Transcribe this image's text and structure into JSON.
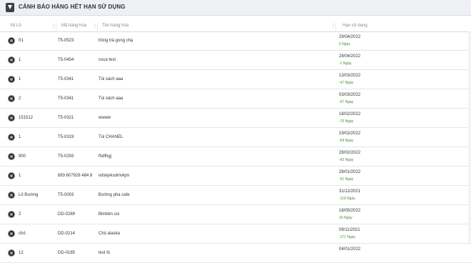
{
  "panel": {
    "icon": "funnel-icon",
    "title": "CẢNH BÁO HÀNG HẾT HẠN SỬ DỤNG"
  },
  "columns": [
    "Số Lô",
    "Mã hàng hóa",
    "Tên hàng hóa",
    "Hạn sử dụng"
  ],
  "rows": [
    {
      "lot": "fr1",
      "code": "T5-0523",
      "name": "hồng trà gong chạ",
      "date": "29/04/2022",
      "days": "0 Ngày"
    },
    {
      "lot": "1",
      "code": "T5-0454",
      "name": "coca test",
      "date": "28/04/2022",
      "days": "-1 Ngày"
    },
    {
      "lot": "1",
      "code": "T5-0341",
      "name": "Túi xách aaa",
      "date": "13/03/2022",
      "days": "-47 Ngày"
    },
    {
      "lot": "2",
      "code": "T5-0341",
      "name": "Túi xách aaa",
      "date": "03/03/2022",
      "days": "-57 Ngày"
    },
    {
      "lot": "151512",
      "code": "T5-0321",
      "name": "wwww",
      "date": "18/02/2022",
      "days": "-70 Ngày"
    },
    {
      "lot": "1",
      "code": "T5-0319",
      "name": "Túi CHANEL",
      "date": "19/02/2022",
      "days": "-69 Ngày"
    },
    {
      "lot": "900",
      "code": "T5-0293",
      "name": "fhdfhgj",
      "date": "28/02/2022",
      "days": "-60 Ngày"
    },
    {
      "lot": "1",
      "code": "893 607928 484 8",
      "name": "vdskjvksdmvkjm",
      "date": "28/01/2022",
      "days": "-91 Ngày"
    },
    {
      "lot": "Lô Đường",
      "code": "T5-0003",
      "name": "Đường pha cafe",
      "date": "31/12/2021",
      "days": "-119 Ngày"
    },
    {
      "lot": "2",
      "code": "DD-0289",
      "name": "Bimbim osi",
      "date": "18/05/2022",
      "days": "19 Ngày"
    },
    {
      "lot": "chó",
      "code": "DD-0214",
      "name": "Chó alaska",
      "date": "09/11/2021",
      "days": "-171 Ngày"
    },
    {
      "lot": "12",
      "code": "DD-0185",
      "name": "test lô",
      "date": "04/01/2022",
      "days": ""
    }
  ]
}
